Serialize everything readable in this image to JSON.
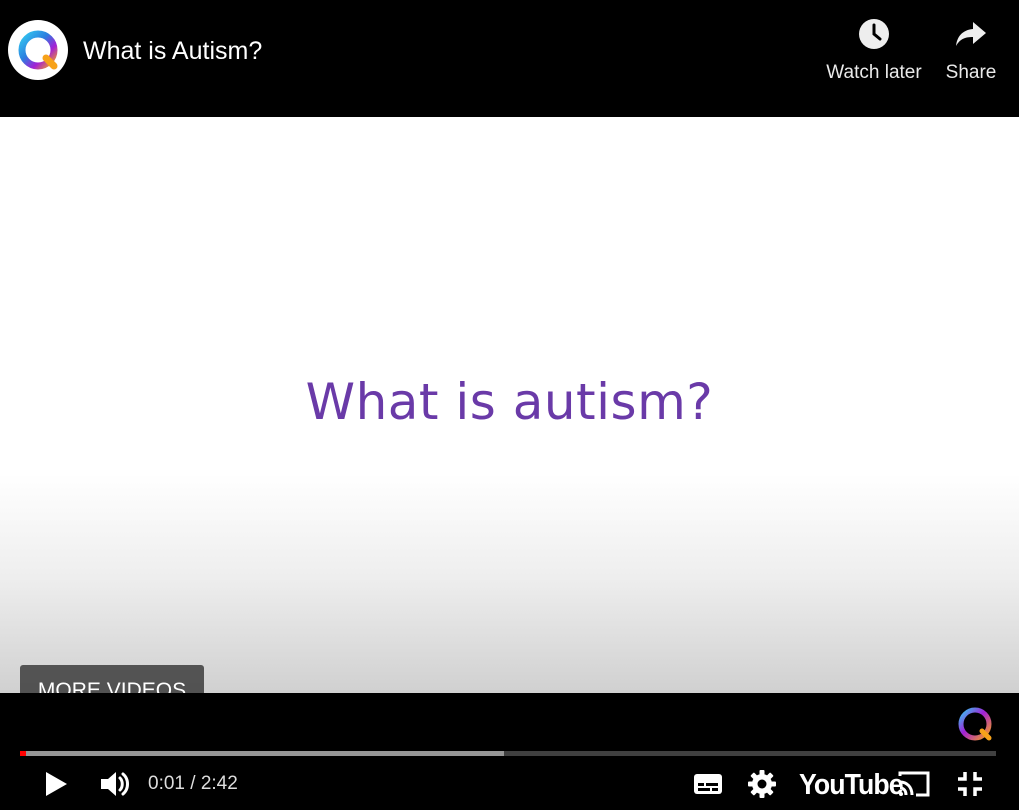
{
  "header": {
    "title": "What is Autism?",
    "watch_later_label": "Watch later",
    "share_label": "Share"
  },
  "video": {
    "frame_text": "What is autism?",
    "current_time": "0:01",
    "duration": "2:42",
    "time_display": "0:01 / 2:42",
    "played_fraction": 0.006,
    "buffered_fraction": 0.496
  },
  "overlay": {
    "more_videos_label": "MORE VIDEOS"
  },
  "controls": {
    "youtube_logo_text": "YouTube",
    "icons": [
      "play-icon",
      "volume-icon",
      "captions-icon",
      "settings-icon",
      "cast-icon",
      "exit-fullscreen-icon",
      "clock-icon",
      "share-arrow-icon"
    ]
  },
  "colors": {
    "progress_played": "#ff0000",
    "frame_text": "#6a3aa8",
    "background": "#000000"
  }
}
